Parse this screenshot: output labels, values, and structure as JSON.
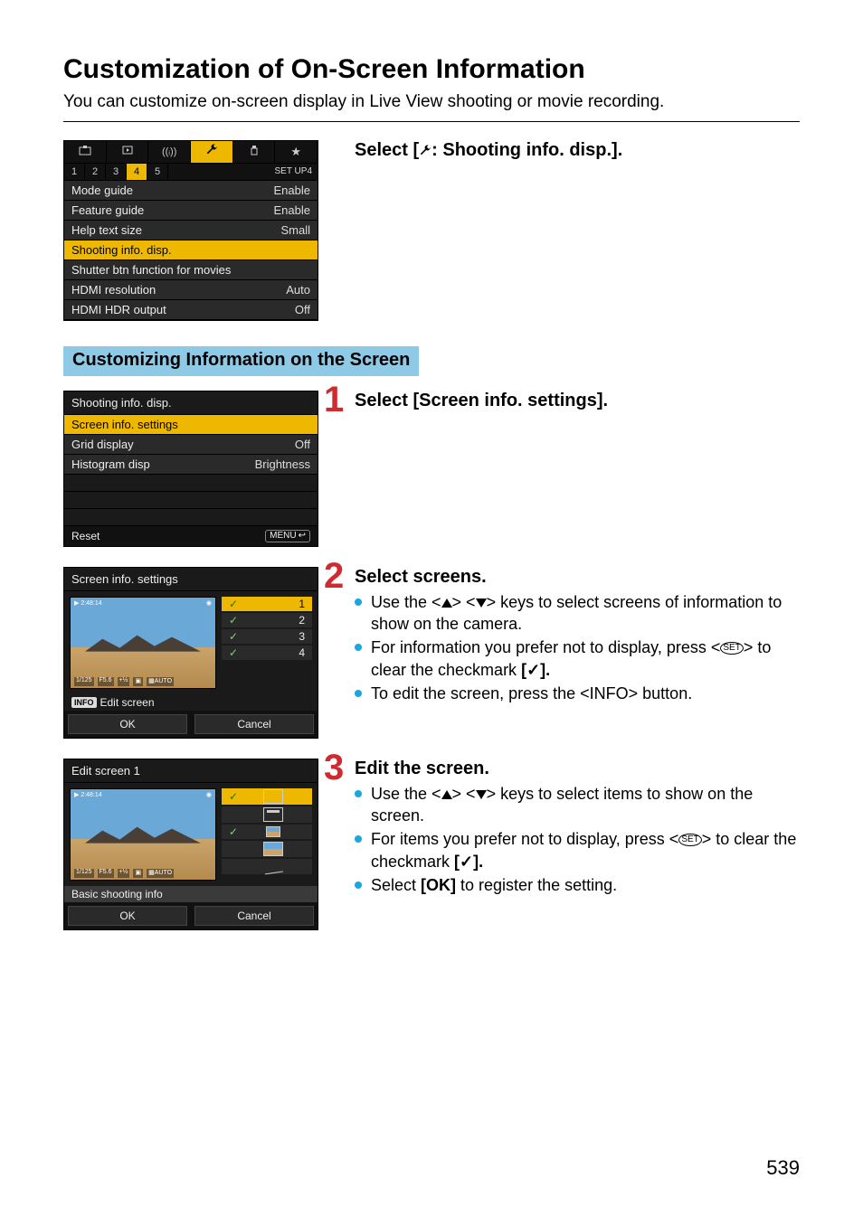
{
  "page_number": "539",
  "title": "Customization of On-Screen Information",
  "intro": "You can customize on-screen display in Live View shooting or movie recording.",
  "section_banner": "Customizing Information on the Screen",
  "step0": {
    "title_pre": "Select [",
    "title_post": ": Shooting info. disp.]."
  },
  "menu1": {
    "subbar_label": "SET UP4",
    "tabs_sub": [
      "1",
      "2",
      "3",
      "4",
      "5"
    ],
    "rows": [
      {
        "name": "Mode guide",
        "val": "Enable",
        "sel": false
      },
      {
        "name": "Feature guide",
        "val": "Enable",
        "sel": false
      },
      {
        "name": "Help text size",
        "val": "Small",
        "sel": false
      },
      {
        "name": "Shooting info. disp.",
        "val": "",
        "sel": true
      },
      {
        "name": "Shutter btn function for movies",
        "val": "",
        "sel": false
      },
      {
        "name": "HDMI resolution",
        "val": "Auto",
        "sel": false
      },
      {
        "name": "HDMI HDR output",
        "val": "Off",
        "sel": false
      }
    ]
  },
  "step1": {
    "num": "1",
    "title": "Select [Screen info. settings]."
  },
  "menu2": {
    "title": "Shooting info. disp.",
    "rows": [
      {
        "name": "Screen info. settings",
        "val": "",
        "sel": true
      },
      {
        "name": "Grid display",
        "val": "Off",
        "sel": false
      },
      {
        "name": "Histogram disp",
        "val": "Brightness",
        "sel": false
      }
    ],
    "footer_left": "Reset",
    "footer_right": "MENU"
  },
  "step2": {
    "num": "2",
    "title": "Select screens.",
    "b1a": "Use the <",
    "b1b": "> <",
    "b1c": "> keys to select screens of information to show on the camera.",
    "b2a": "For information you prefer not to display, press <",
    "b2b": "> to clear the checkmark ",
    "b2c": "[",
    "b2d": "✓",
    "b2e": "].",
    "b3a": "To edit the screen, press the <",
    "b3b": "INFO",
    "b3c": "> button."
  },
  "menu3": {
    "title": "Screen info. settings",
    "checks": [
      {
        "ck": "✓",
        "n": "1",
        "sel": true
      },
      {
        "ck": "✓",
        "n": "2",
        "sel": false
      },
      {
        "ck": "✓",
        "n": "3",
        "sel": false
      },
      {
        "ck": "✓",
        "n": "4",
        "sel": false
      }
    ],
    "info_label": "INFO",
    "info_text": "Edit screen",
    "ok": "OK",
    "cancel": "Cancel"
  },
  "step3": {
    "num": "3",
    "title": "Edit the screen.",
    "b1a": "Use the <",
    "b1b": "> <",
    "b1c": "> keys to select items to show on the screen.",
    "b2a": "For items you prefer not to display, press <",
    "b2b": "> to clear the checkmark ",
    "b2c": "[",
    "b2d": "✓",
    "b2e": "].",
    "b3a": "Select ",
    "b3b": "[OK]",
    "b3c": " to register the setting."
  },
  "menu4": {
    "title": "Edit screen 1",
    "rows": [
      {
        "ck": "✓",
        "icon": "box",
        "sel": true
      },
      {
        "ck": "",
        "icon": "boxbars",
        "sel": false
      },
      {
        "ck": "✓",
        "icon": "picsm",
        "sel": false
      },
      {
        "ck": "",
        "icon": "pic",
        "sel": false
      },
      {
        "ck": "",
        "icon": "level",
        "sel": false
      }
    ],
    "caption": "Basic shooting info",
    "ok": "OK",
    "cancel": "Cancel"
  },
  "set_label": "SET"
}
